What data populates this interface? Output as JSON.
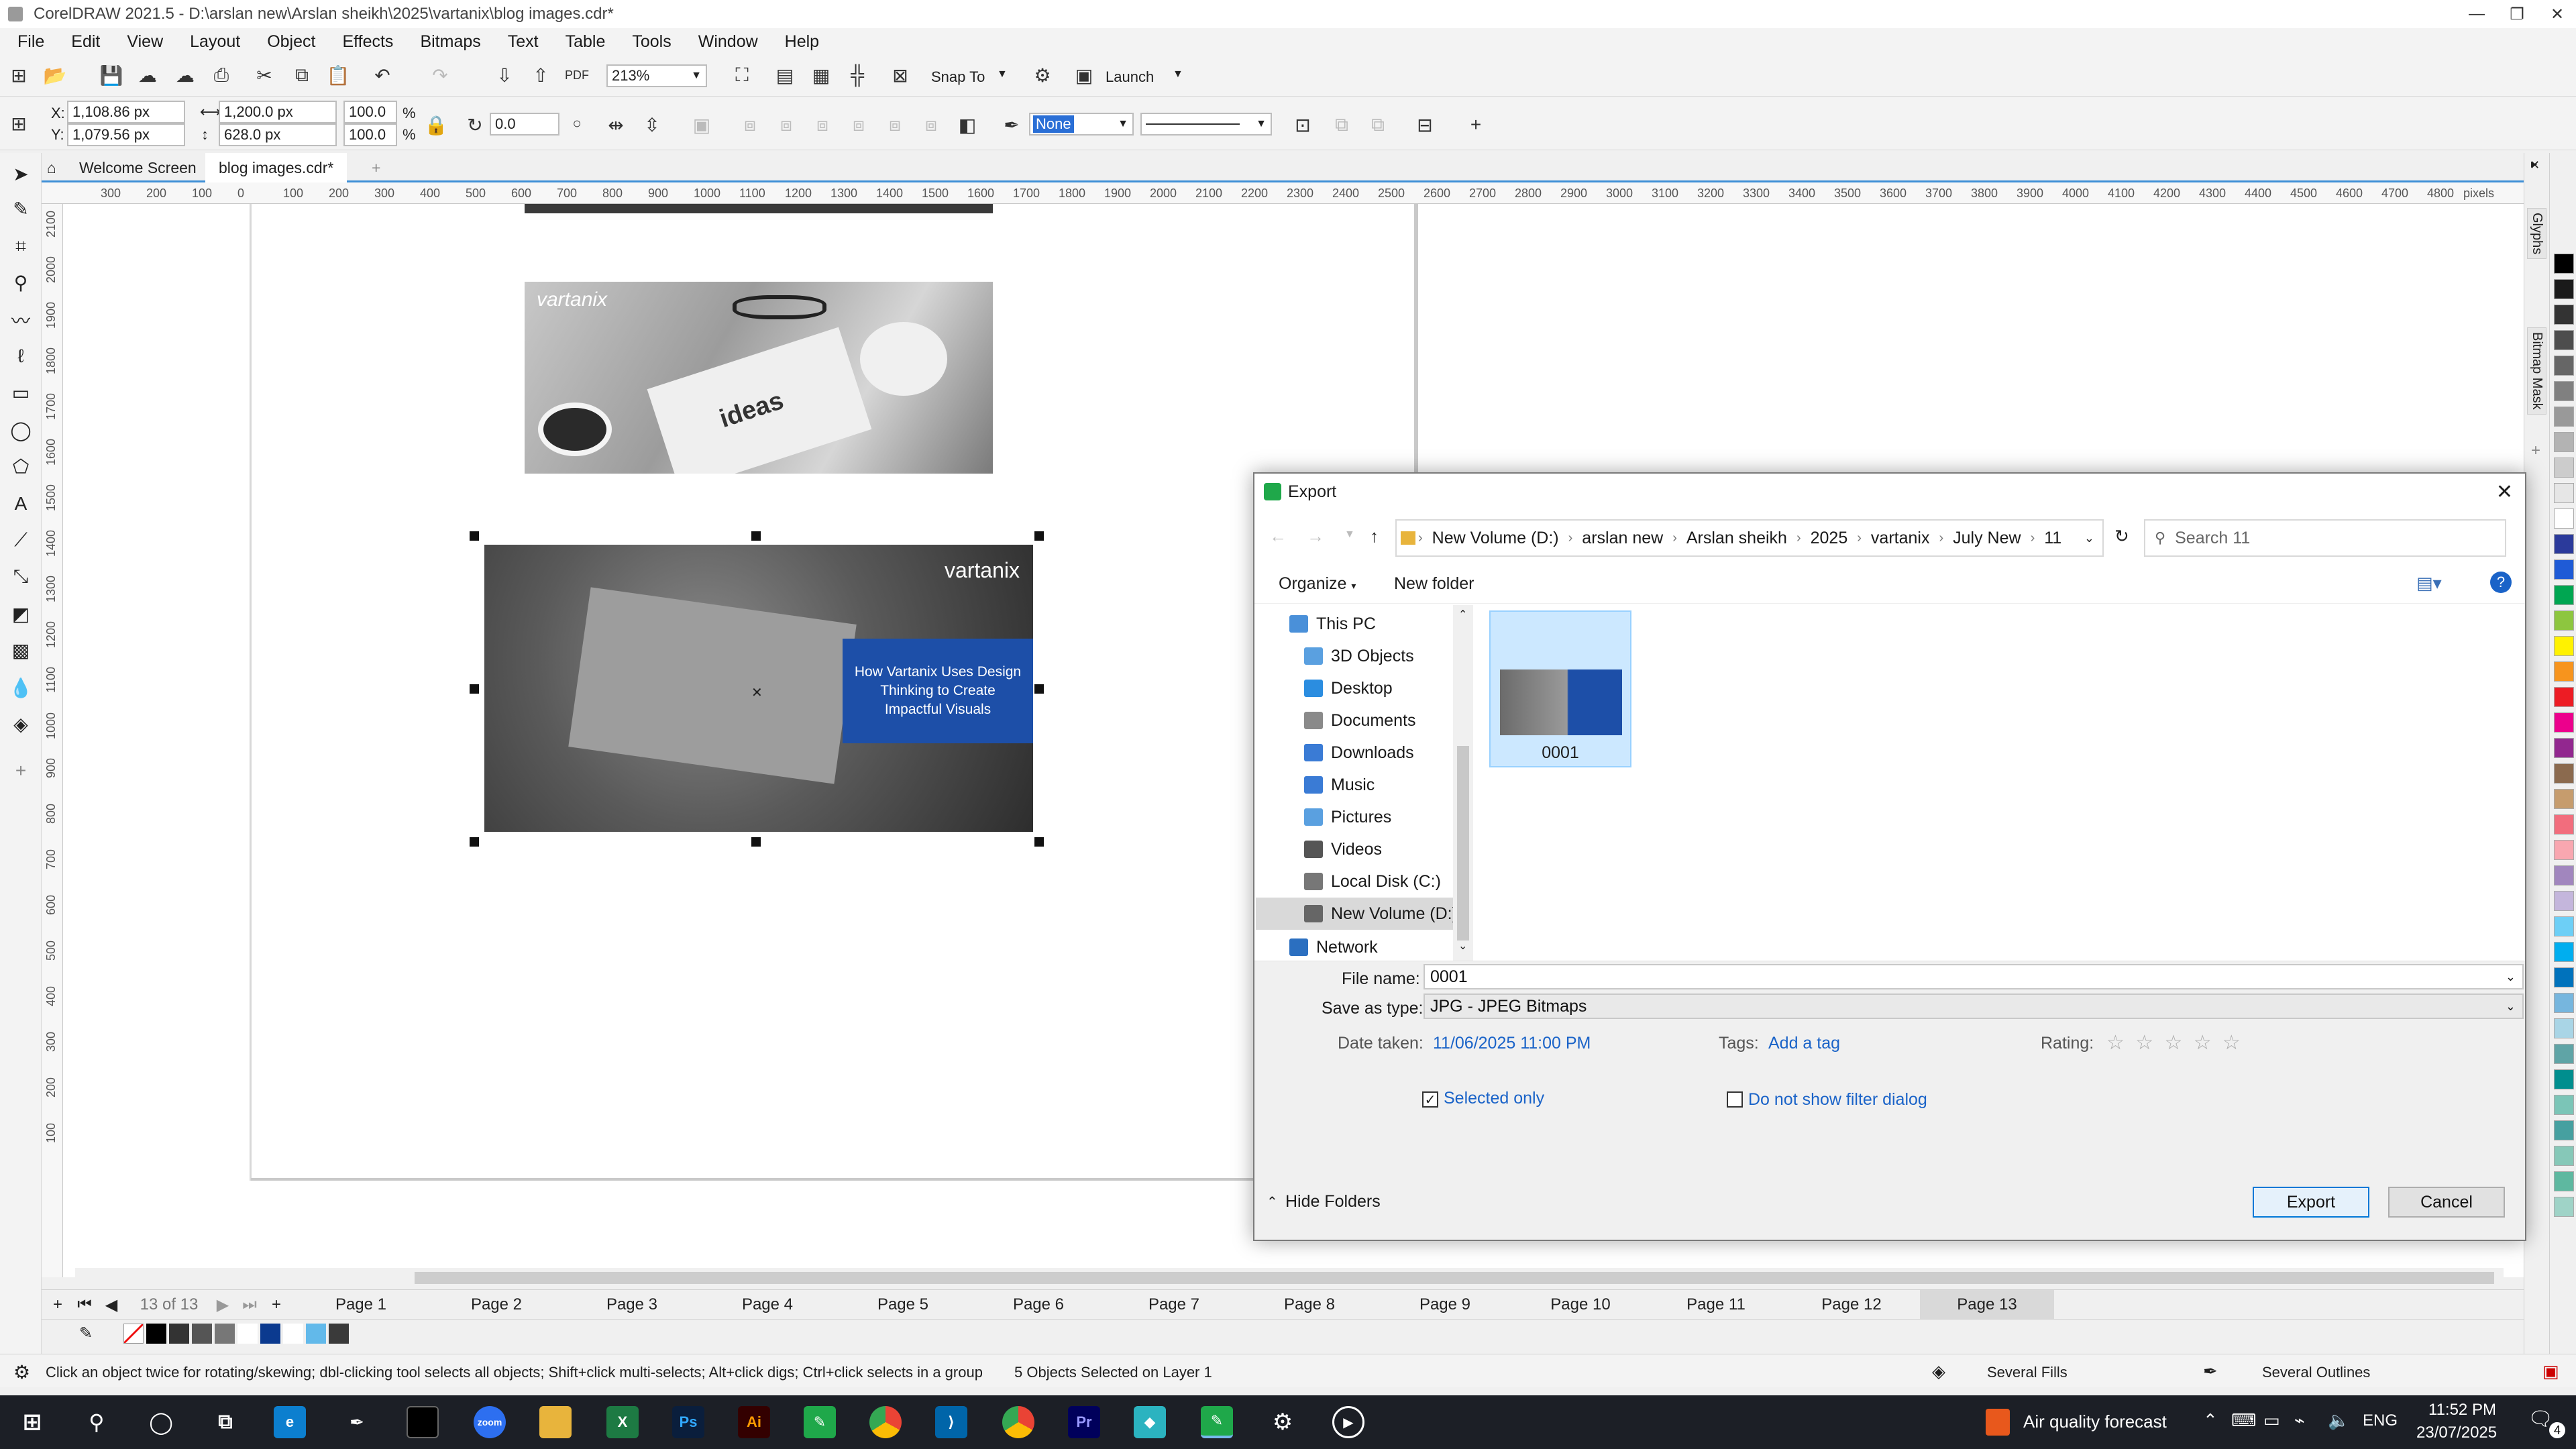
{
  "window": {
    "title": "CorelDRAW 2021.5 - D:\\arslan new\\Arslan sheikh\\2025\\vartanix\\blog images.cdr*",
    "controls": [
      "—",
      "❐",
      "✕"
    ]
  },
  "menu": [
    "File",
    "Edit",
    "View",
    "Layout",
    "Object",
    "Effects",
    "Bitmaps",
    "Text",
    "Table",
    "Tools",
    "Window",
    "Help"
  ],
  "standard_toolbar": {
    "zoom": "213%",
    "snap_to": "Snap To",
    "launch": "Launch"
  },
  "property_bar": {
    "x_label": "X:",
    "x": "1,108.86 px",
    "y_label": "Y:",
    "y": "1,079.56 px",
    "width": "1,200.0 px",
    "height": "628.0 px",
    "scale_x": "100.0",
    "scale_y": "100.0",
    "percent": "%",
    "rotation": "0.0",
    "outline_width": "None"
  },
  "doc_tabs": [
    "Welcome Screen",
    "blog images.cdr*"
  ],
  "ruler_h_ticks": [
    "300",
    "200",
    "100",
    "0",
    "100",
    "200",
    "300",
    "400",
    "500",
    "600",
    "700",
    "800",
    "900",
    "1000",
    "1100",
    "1200",
    "1300",
    "1400",
    "1500",
    "1600",
    "1700",
    "1800",
    "1900",
    "2000",
    "2100",
    "2200",
    "2300",
    "2400",
    "2500",
    "2600",
    "2700",
    "2800",
    "2900",
    "3000",
    "3100",
    "3200",
    "3300",
    "3400",
    "3500",
    "3600",
    "3700",
    "3800",
    "3900",
    "4000",
    "4100",
    "4200",
    "4300",
    "4400",
    "4500",
    "4600",
    "4700",
    "4800"
  ],
  "ruler_unit": "pixels",
  "ruler_v_ticks": [
    "2100",
    "2000",
    "1900",
    "1800",
    "1700",
    "1600",
    "1500",
    "1400",
    "1300",
    "1200",
    "1100",
    "1000",
    "900",
    "800",
    "700",
    "600",
    "500",
    "400",
    "300",
    "200",
    "100"
  ],
  "canvas": {
    "image1_logo": "vartanix",
    "image2_logo": "vartanix",
    "image2_caption": "How Vartanix Uses Design Thinking to Create Impactful Visuals",
    "photo_text": "ideas"
  },
  "docker_tabs": [
    "Glyphs",
    "Bitmap Mask"
  ],
  "palette_colors": [
    "#000000",
    "#1a1a1a",
    "#333333",
    "#4d4d4d",
    "#666666",
    "#808080",
    "#999999",
    "#b3b3b3",
    "#cccccc",
    "#e6e6e6",
    "#ffffff",
    "#2b3a9b",
    "#1f5bd6",
    "#00a651",
    "#8dc63f",
    "#fff200",
    "#f7941d",
    "#ed1c24",
    "#ec008c",
    "#92278f",
    "#8b6a4e",
    "#c69c6d",
    "#f26d7d",
    "#f9a7b0",
    "#a186be",
    "#c4b6dc",
    "#6dcff6",
    "#00aeef",
    "#0072bc",
    "#76b6de",
    "#a9d5e6",
    "#5fa4a6",
    "#008e8e",
    "#7bc5b7",
    "#46a0a0",
    "#86c8b8",
    "#5eb8a0",
    "#9fd3c7"
  ],
  "page_nav": {
    "counter": "13 of 13",
    "pages": [
      "Page 1",
      "Page 2",
      "Page 3",
      "Page 4",
      "Page 5",
      "Page 6",
      "Page 7",
      "Page 8",
      "Page 9",
      "Page 10",
      "Page 11",
      "Page 12",
      "Page 13"
    ],
    "active": "Page 13"
  },
  "doc_palette": [
    "#000000",
    "#333333",
    "#555555",
    "#777777",
    "#ffffff",
    "#0b3a8f",
    "#ffffff",
    "#62b9ea",
    "#3a3a3a"
  ],
  "status": {
    "hint": "Click an object twice for rotating/skewing; dbl-clicking tool selects all objects; Shift+click multi-selects; Alt+click digs; Ctrl+click selects in a group",
    "selection": "5 Objects Selected on Layer 1",
    "fill": "Several Fills",
    "outline": "Several Outlines"
  },
  "export_dialog": {
    "title": "Export",
    "breadcrumbs": [
      "New Volume (D:)",
      "arslan new",
      "Arslan sheikh",
      "2025",
      "vartanix",
      "July New",
      "11"
    ],
    "search_placeholder": "Search 11",
    "organize": "Organize",
    "new_folder": "New folder",
    "nav_items": [
      "This PC",
      "3D Objects",
      "Desktop",
      "Documents",
      "Downloads",
      "Music",
      "Pictures",
      "Videos",
      "Local Disk (C:)",
      "New Volume (D:)",
      "Network"
    ],
    "file_item": "0001",
    "file_name_label": "File name:",
    "file_name": "0001",
    "save_as_label": "Save as type:",
    "save_as": "JPG - JPEG Bitmaps",
    "date_taken_label": "Date taken:",
    "date_taken": "11/06/2025 11:00 PM",
    "tags_label": "Tags:",
    "tags_value": "Add a tag",
    "rating_label": "Rating:",
    "rating_stars": "☆ ☆ ☆ ☆ ☆",
    "selected_only": "Selected only",
    "dont_show_filter": "Do not show filter dialog",
    "hide_folders": "Hide Folders",
    "export_btn": "Export",
    "cancel_btn": "Cancel"
  },
  "taskbar": {
    "weather": "Air quality forecast",
    "lang": "ENG",
    "time": "11:52 PM",
    "date": "23/07/2025",
    "notif_count": "4"
  }
}
